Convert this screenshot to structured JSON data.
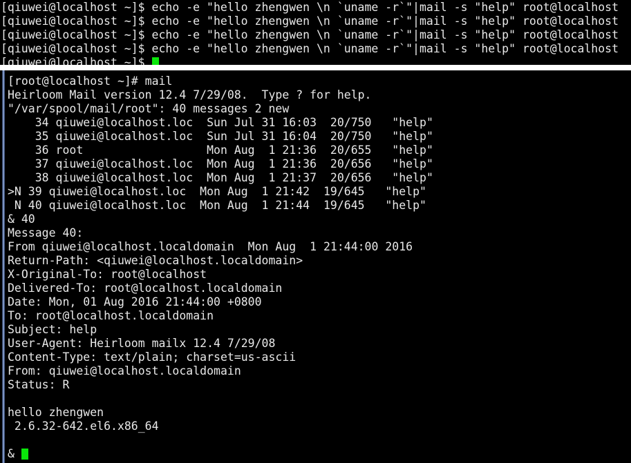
{
  "theme": {
    "background": "#000000",
    "foreground": "#e8e8e8",
    "cursor": "#0ae60a",
    "splitter": "#ffffff",
    "focus_strip": "#8fa8d8"
  },
  "top_pane": {
    "name": "shell-terminal-pane",
    "prompt": "[qiuwei@localhost ~]$ ",
    "command": "echo -e \"hello zhengwen \\n `uname -r`\"|mail -s \"help\" root@localhost",
    "lines": [
      "[qiuwei@localhost ~]$ echo -e \"hello zhengwen \\n `uname -r`\"|mail -s \"help\" root@localhost",
      "[qiuwei@localhost ~]$ echo -e \"hello zhengwen \\n `uname -r`\"|mail -s \"help\" root@localhost",
      "[qiuwei@localhost ~]$ echo -e \"hello zhengwen \\n `uname -r`\"|mail -s \"help\" root@localhost",
      "[qiuwei@localhost ~]$ echo -e \"hello zhengwen \\n `uname -r`\"|mail -s \"help\" root@localhost"
    ],
    "cursor_prompt": "[qiuwei@localhost ~]$ "
  },
  "bottom_pane": {
    "name": "mail-client-terminal-pane",
    "root_prompt": "[root@localhost ~]# ",
    "root_command": "mail",
    "banner": "Heirloom Mail version 12.4 7/29/08.  Type ? for help.",
    "mailbox_status": "\"/var/spool/mail/root\": 40 messages 2 new",
    "mail_list": [
      "    34 qiuwei@localhost.loc  Sun Jul 31 16:03  20/750   \"help\"",
      "    35 qiuwei@localhost.loc  Sun Jul 31 16:04  20/750   \"help\"",
      "    36 root                  Mon Aug  1 21:36  20/655   \"help\"",
      "    37 qiuwei@localhost.loc  Mon Aug  1 21:36  20/656   \"help\"",
      "    38 qiuwei@localhost.loc  Mon Aug  1 21:37  20/656   \"help\"",
      ">N 39 qiuwei@localhost.loc  Mon Aug  1 21:42  19/645   \"help\"",
      " N 40 qiuwei@localhost.loc  Mon Aug  1 21:44  19/645   \"help\""
    ],
    "mail_messages": [
      {
        "flags": "",
        "number": "34",
        "from": "qiuwei@localhost.loc",
        "date": "Sun Jul 31 16:03",
        "size": "20/750",
        "subject": "\"help\""
      },
      {
        "flags": "",
        "number": "35",
        "from": "qiuwei@localhost.loc",
        "date": "Sun Jul 31 16:04",
        "size": "20/750",
        "subject": "\"help\""
      },
      {
        "flags": "",
        "number": "36",
        "from": "root",
        "date": "Mon Aug  1 21:36",
        "size": "20/655",
        "subject": "\"help\""
      },
      {
        "flags": "",
        "number": "37",
        "from": "qiuwei@localhost.loc",
        "date": "Mon Aug  1 21:36",
        "size": "20/656",
        "subject": "\"help\""
      },
      {
        "flags": "",
        "number": "38",
        "from": "qiuwei@localhost.loc",
        "date": "Mon Aug  1 21:37",
        "size": "20/656",
        "subject": "\"help\""
      },
      {
        "flags": ">N",
        "number": "39",
        "from": "qiuwei@localhost.loc",
        "date": "Mon Aug  1 21:42",
        "size": "19/645",
        "subject": "\"help\""
      },
      {
        "flags": "N",
        "number": "40",
        "from": "qiuwei@localhost.loc",
        "date": "Mon Aug  1 21:44",
        "size": "19/645",
        "subject": "\"help\""
      }
    ],
    "mail_prompt_command": "& 40",
    "message_header_title": "Message 40:",
    "headers": [
      "From qiuwei@localhost.localdomain  Mon Aug  1 21:44:00 2016",
      "Return-Path: <qiuwei@localhost.localdomain>",
      "X-Original-To: root@localhost",
      "Delivered-To: root@localhost.localdomain",
      "Date: Mon, 01 Aug 2016 21:44:00 +0800",
      "To: root@localhost.localdomain",
      "Subject: help",
      "User-Agent: Heirloom mailx 12.4 7/29/08",
      "Content-Type: text/plain; charset=us-ascii",
      "From: qiuwei@localhost.localdomain",
      "Status: R"
    ],
    "body": [
      "hello zhengwen",
      " 2.6.32-642.el6.x86_64"
    ],
    "final_prompt": "& "
  }
}
